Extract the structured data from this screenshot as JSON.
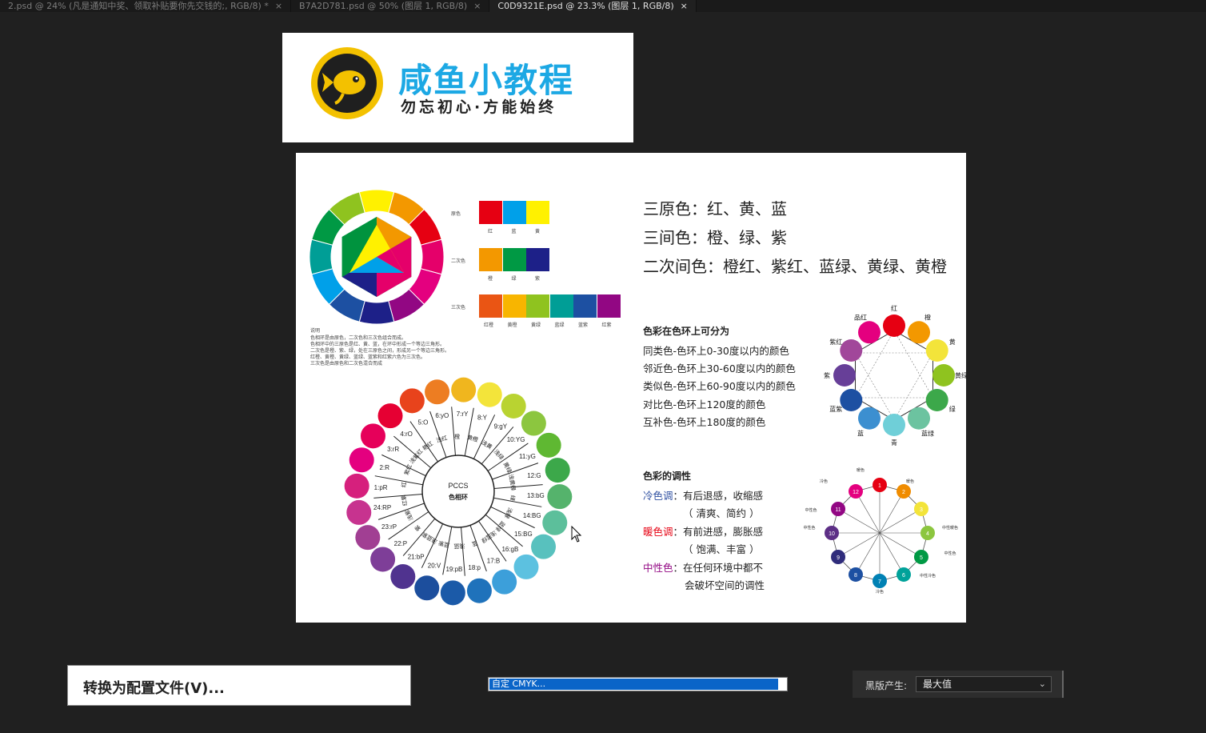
{
  "tabs": [
    {
      "label": "2.psd @ 24% (凡是通知中奖、领取补贴要你先交钱的;, RGB/8) *",
      "active": false
    },
    {
      "label": "B7A2D781.psd @ 50% (图层 1, RGB/8)",
      "active": false
    },
    {
      "label": "C0D9321E.psd @ 23.3% (图层 1, RGB/8)",
      "active": true
    }
  ],
  "tab_close": "×",
  "logo": {
    "title": "咸鱼小教程",
    "slogan": "勿忘初心·方能始终",
    "brand_color": "#1ca8e4",
    "accent_color": "#f3c100"
  },
  "doc": {
    "swatch_rows": [
      {
        "label": "原色",
        "colors": [
          "#e60012",
          "#00a0e9",
          "#fff100"
        ],
        "names": [
          "红",
          "蓝",
          "黄"
        ]
      },
      {
        "label": "二次色",
        "colors": [
          "#f39800",
          "#009944",
          "#1d2088"
        ],
        "names": [
          "橙",
          "绿",
          "紫"
        ]
      },
      {
        "label": "三次色",
        "colors": [
          "#ea5514",
          "#f8b500",
          "#8fc31f",
          "#009e96",
          "#1d50a2",
          "#920783"
        ],
        "names": [
          "红橙",
          "黄橙",
          "黄绿",
          "蓝绿",
          "蓝紫",
          "红紫"
        ]
      }
    ],
    "explain_title": "说明",
    "explain_lines": [
      "色相环是由原色，二次色和三次色组合而成。",
      "色相环中的三原色是红、黄、蓝，在环中形成一个等边三角形。",
      "二次色是橙、紫、绿，处在三原色之间，形成另一个等边三角形。",
      "红橙、黄橙、黄绿、蓝绿、蓝紫和红紫六色为三次色。",
      "三次色是由原色和二次色混合而成"
    ],
    "primary_line": "三原色：红、黄、蓝",
    "secondary_line": "三间色：橙、绿、紫",
    "tertiary_line": "二次间色：橙红、紫红、蓝绿、黄绿、黄橙",
    "ring_heading": "色彩在色环上可分为",
    "ring_lines": [
      "同类色-色环上0-30度以内的颜色",
      "邻近色-色环上30-60度以内的颜色",
      "类似色-色环上60-90度以内的颜色",
      "对比色-色环上120度的颜色",
      "互补色-色环上180度的颜色"
    ],
    "tone_heading": "色彩的调性",
    "tones": [
      {
        "name": "冷色调",
        "color": "#2e4fa0",
        "text": "：有后退感，收缩感",
        "text2": "（ 清爽、简约 ）"
      },
      {
        "name": "暖色调",
        "color": "#e60012",
        "text": "：有前进感，膨胀感",
        "text2": "（ 饱满、丰富 ）"
      },
      {
        "name": "中性色",
        "color": "#920783",
        "text": "：在任何环境中都不",
        "text2": "会破坏空间的调性"
      }
    ],
    "pccs_center_1": "PCCS",
    "pccs_center_2": "色相环",
    "pccs_codes": [
      "1:pR",
      "2:R",
      "3:rR",
      "4:rO",
      "5:O",
      "6:yO",
      "7:rY",
      "8:Y",
      "9:gY",
      "10:YG",
      "11:yG",
      "12:G",
      "13:bG",
      "14:BG",
      "15:BG",
      "16:gB",
      "17:B",
      "18:p",
      "19:pB",
      "20:V",
      "21:bP",
      "22:P",
      "23:rP",
      "24:RP"
    ],
    "pccs_colors": [
      "#d6207d",
      "#e4007f",
      "#e6005a",
      "#e60033",
      "#e8431c",
      "#ed7d22",
      "#f0b61e",
      "#f3e43a",
      "#b9d331",
      "#8cc63f",
      "#5fb832",
      "#3ca84a",
      "#55b36c",
      "#5cbf9b",
      "#58c1be",
      "#5cc1e0",
      "#3c9fda",
      "#1f72bb",
      "#1b5aa8",
      "#1c4e9d",
      "#50338f",
      "#7e3e98",
      "#a13f93",
      "#c7338f"
    ],
    "pccs_names": [
      "红",
      "紫红",
      "浅紫红",
      "艳红",
      "浅红",
      "橙",
      "黄橙",
      "浅黄",
      "浅绿",
      "黄绿",
      "浅黄绿",
      "绿",
      "浅绿",
      "蓝绿",
      "浅蓝绿",
      "蓝",
      "浅蓝",
      "蓝紫",
      "浅蓝紫",
      "紫",
      "浅紫",
      "红紫"
    ],
    "wheel12_labels": [
      "红",
      "橙",
      "黄",
      "黄绿",
      "绿",
      "蓝绿",
      "青",
      "蓝",
      "蓝紫",
      "紫",
      "紫红",
      "品红"
    ],
    "wheel12_colors": [
      "#e60012",
      "#f39800",
      "#f3e43a",
      "#8fc31f",
      "#3ca84a",
      "#6cc3a0",
      "#6fcfd8",
      "#3c8fd0",
      "#1d50a2",
      "#673f98",
      "#a1479a",
      "#e4007f"
    ],
    "tone_wheel_numbers": [
      "1",
      "2",
      "3",
      "4",
      "5",
      "6",
      "7",
      "8",
      "9",
      "10",
      "11",
      "12"
    ],
    "tone_wheel_colors": [
      "#e60012",
      "#f08c00",
      "#f3e43a",
      "#8cc63f",
      "#009944",
      "#00a29a",
      "#0081b4",
      "#1d50a2",
      "#2f2c7b",
      "#5d2f86",
      "#920783",
      "#e4007f"
    ],
    "tone_wheel_labels": [
      "暖色",
      "暖色",
      "中性暖色",
      "中性色",
      "中性冷色",
      "冷色",
      "冷色",
      "中性色",
      "中性色"
    ]
  },
  "dialog": {
    "convert_label": "转换为配置文件(V)...",
    "cmyk_value": "自定 CMYK...",
    "black_gen_label": "黑版产生:",
    "black_gen_value": "最大值",
    "chevron": "⌄"
  }
}
